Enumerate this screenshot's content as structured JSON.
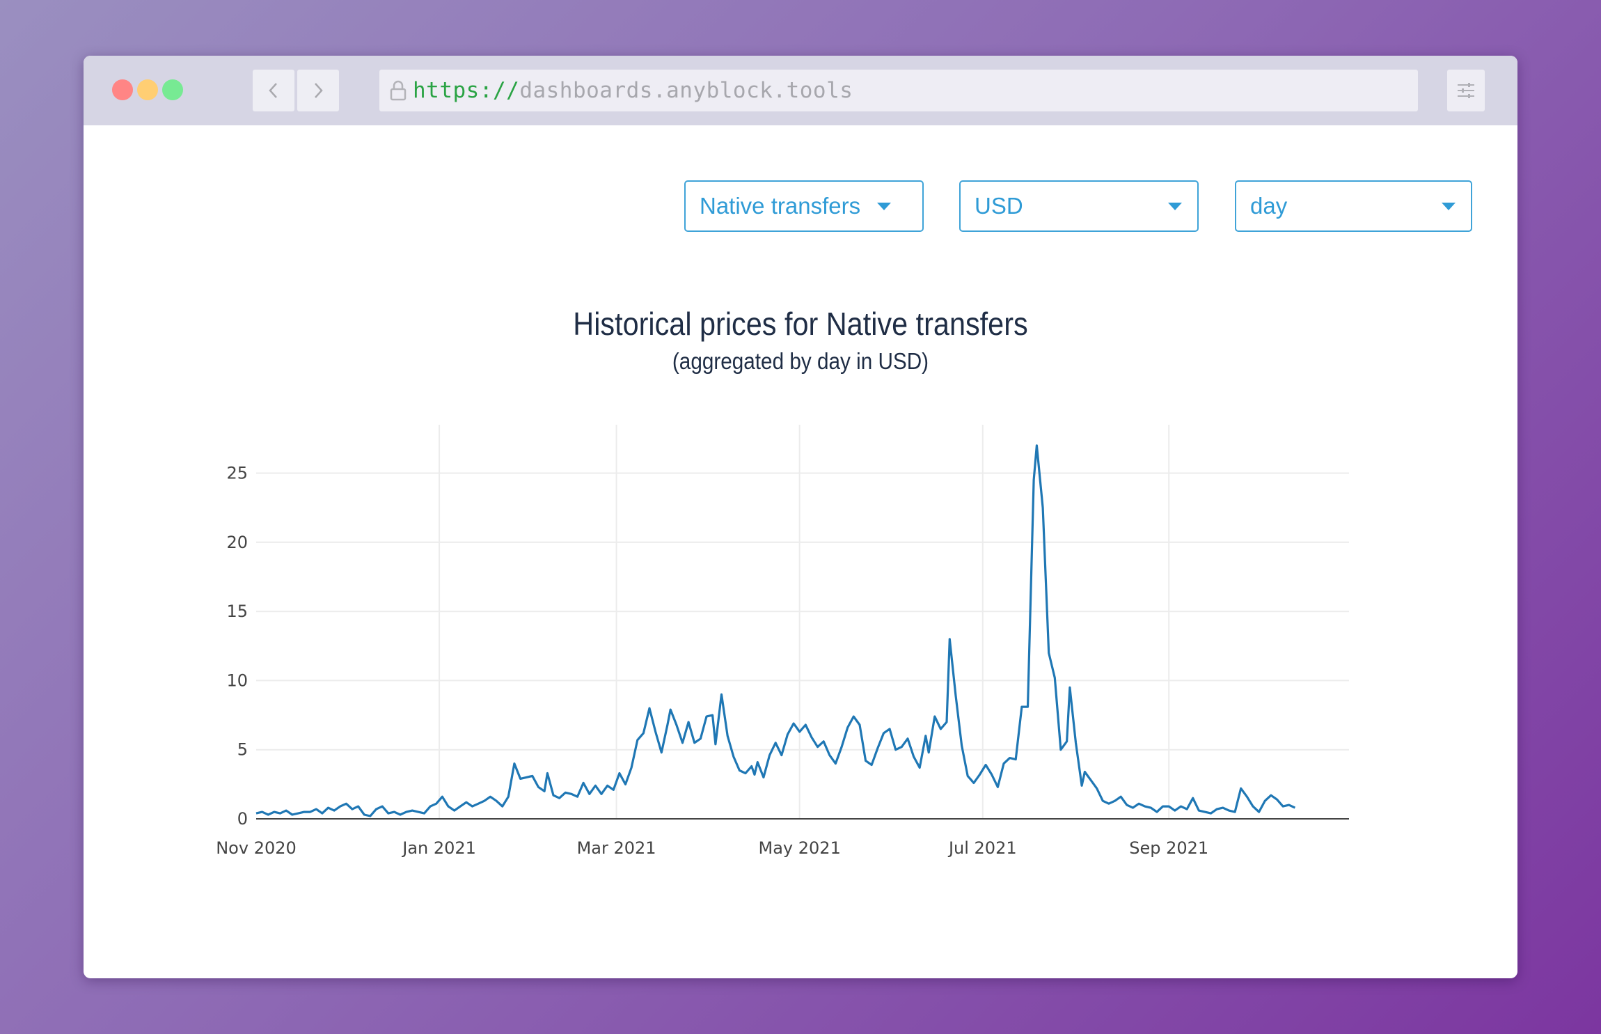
{
  "browser": {
    "url_scheme": "https://",
    "url_host": "dashboards.anyblock.tools",
    "icons": {
      "back": "chevron-left-icon",
      "forward": "chevron-right-icon",
      "lock": "lock-icon",
      "settings": "sliders-icon"
    },
    "traffic_lights": [
      "#ff8585",
      "#ffce73",
      "#77ea93"
    ]
  },
  "controls": {
    "metric_select": {
      "value": "Native transfers"
    },
    "currency_select": {
      "value": "USD"
    },
    "interval_select": {
      "value": "day"
    },
    "accent_color": "#2f9bd6"
  },
  "chart_data": {
    "type": "line",
    "title": "Historical prices for Native transfers",
    "subtitle": "(aggregated by day in USD)",
    "xlabel": "",
    "ylabel": "",
    "x_tick_labels": [
      "Nov 2020",
      "Jan 2021",
      "Mar 2021",
      "May 2021",
      "Jul 2021",
      "Sep 2021"
    ],
    "x_ticks": [
      "2020-11-01",
      "2021-01-01",
      "2021-03-01",
      "2021-05-01",
      "2021-07-01",
      "2021-09-01"
    ],
    "y_ticks": [
      0,
      5,
      10,
      15,
      20,
      25
    ],
    "ylim": [
      0,
      28.5
    ],
    "xlim": [
      "2020-11-01",
      "2021-10-31"
    ],
    "grid": true,
    "legend": "none",
    "line_color": "#1f77b4",
    "series": [
      {
        "name": "Native transfers",
        "points": [
          [
            "2020-11-01",
            0.4
          ],
          [
            "2020-11-03",
            0.5
          ],
          [
            "2020-11-05",
            0.3
          ],
          [
            "2020-11-07",
            0.5
          ],
          [
            "2020-11-09",
            0.4
          ],
          [
            "2020-11-11",
            0.6
          ],
          [
            "2020-11-13",
            0.3
          ],
          [
            "2020-11-15",
            0.4
          ],
          [
            "2020-11-17",
            0.5
          ],
          [
            "2020-11-19",
            0.5
          ],
          [
            "2020-11-21",
            0.7
          ],
          [
            "2020-11-23",
            0.4
          ],
          [
            "2020-11-25",
            0.8
          ],
          [
            "2020-11-27",
            0.6
          ],
          [
            "2020-11-29",
            0.9
          ],
          [
            "2020-12-01",
            1.1
          ],
          [
            "2020-12-03",
            0.7
          ],
          [
            "2020-12-05",
            0.9
          ],
          [
            "2020-12-07",
            0.3
          ],
          [
            "2020-12-09",
            0.2
          ],
          [
            "2020-12-11",
            0.7
          ],
          [
            "2020-12-13",
            0.9
          ],
          [
            "2020-12-15",
            0.4
          ],
          [
            "2020-12-17",
            0.5
          ],
          [
            "2020-12-19",
            0.3
          ],
          [
            "2020-12-21",
            0.5
          ],
          [
            "2020-12-23",
            0.6
          ],
          [
            "2020-12-25",
            0.5
          ],
          [
            "2020-12-27",
            0.4
          ],
          [
            "2020-12-29",
            0.9
          ],
          [
            "2020-12-31",
            1.1
          ],
          [
            "2021-01-02",
            1.6
          ],
          [
            "2021-01-04",
            0.9
          ],
          [
            "2021-01-06",
            0.6
          ],
          [
            "2021-01-08",
            0.9
          ],
          [
            "2021-01-10",
            1.2
          ],
          [
            "2021-01-12",
            0.9
          ],
          [
            "2021-01-14",
            1.1
          ],
          [
            "2021-01-16",
            1.3
          ],
          [
            "2021-01-18",
            1.6
          ],
          [
            "2021-01-20",
            1.3
          ],
          [
            "2021-01-22",
            0.9
          ],
          [
            "2021-01-24",
            1.6
          ],
          [
            "2021-01-26",
            4.0
          ],
          [
            "2021-01-28",
            2.9
          ],
          [
            "2021-01-30",
            3.0
          ],
          [
            "2021-02-01",
            3.1
          ],
          [
            "2021-02-03",
            2.3
          ],
          [
            "2021-02-05",
            2.0
          ],
          [
            "2021-02-06",
            3.3
          ],
          [
            "2021-02-08",
            1.7
          ],
          [
            "2021-02-10",
            1.5
          ],
          [
            "2021-02-12",
            1.9
          ],
          [
            "2021-02-14",
            1.8
          ],
          [
            "2021-02-16",
            1.6
          ],
          [
            "2021-02-18",
            2.6
          ],
          [
            "2021-02-20",
            1.8
          ],
          [
            "2021-02-22",
            2.4
          ],
          [
            "2021-02-24",
            1.8
          ],
          [
            "2021-02-26",
            2.4
          ],
          [
            "2021-02-28",
            2.1
          ],
          [
            "2021-03-02",
            3.3
          ],
          [
            "2021-03-04",
            2.5
          ],
          [
            "2021-03-06",
            3.7
          ],
          [
            "2021-03-08",
            5.7
          ],
          [
            "2021-03-10",
            6.2
          ],
          [
            "2021-03-12",
            8.0
          ],
          [
            "2021-03-14",
            6.3
          ],
          [
            "2021-03-16",
            4.8
          ],
          [
            "2021-03-18",
            6.8
          ],
          [
            "2021-03-19",
            7.9
          ],
          [
            "2021-03-21",
            6.8
          ],
          [
            "2021-03-23",
            5.5
          ],
          [
            "2021-03-25",
            7.0
          ],
          [
            "2021-03-27",
            5.5
          ],
          [
            "2021-03-29",
            5.8
          ],
          [
            "2021-03-31",
            7.4
          ],
          [
            "2021-04-02",
            7.5
          ],
          [
            "2021-04-03",
            5.4
          ],
          [
            "2021-04-05",
            9.0
          ],
          [
            "2021-04-07",
            6.0
          ],
          [
            "2021-04-09",
            4.5
          ],
          [
            "2021-04-11",
            3.5
          ],
          [
            "2021-04-13",
            3.3
          ],
          [
            "2021-04-15",
            3.8
          ],
          [
            "2021-04-16",
            3.2
          ],
          [
            "2021-04-17",
            4.1
          ],
          [
            "2021-04-19",
            3.0
          ],
          [
            "2021-04-21",
            4.6
          ],
          [
            "2021-04-23",
            5.5
          ],
          [
            "2021-04-25",
            4.6
          ],
          [
            "2021-04-27",
            6.1
          ],
          [
            "2021-04-29",
            6.9
          ],
          [
            "2021-05-01",
            6.3
          ],
          [
            "2021-05-03",
            6.8
          ],
          [
            "2021-05-05",
            5.9
          ],
          [
            "2021-05-07",
            5.2
          ],
          [
            "2021-05-09",
            5.6
          ],
          [
            "2021-05-11",
            4.6
          ],
          [
            "2021-05-13",
            4.0
          ],
          [
            "2021-05-15",
            5.2
          ],
          [
            "2021-05-17",
            6.6
          ],
          [
            "2021-05-19",
            7.4
          ],
          [
            "2021-05-21",
            6.8
          ],
          [
            "2021-05-23",
            4.2
          ],
          [
            "2021-05-25",
            3.9
          ],
          [
            "2021-05-27",
            5.1
          ],
          [
            "2021-05-29",
            6.2
          ],
          [
            "2021-05-31",
            6.5
          ],
          [
            "2021-06-02",
            5.0
          ],
          [
            "2021-06-04",
            5.2
          ],
          [
            "2021-06-06",
            5.8
          ],
          [
            "2021-06-08",
            4.5
          ],
          [
            "2021-06-10",
            3.7
          ],
          [
            "2021-06-12",
            6.0
          ],
          [
            "2021-06-13",
            4.8
          ],
          [
            "2021-06-15",
            7.4
          ],
          [
            "2021-06-17",
            6.5
          ],
          [
            "2021-06-19",
            7.0
          ],
          [
            "2021-06-20",
            13.0
          ],
          [
            "2021-06-22",
            8.9
          ],
          [
            "2021-06-24",
            5.3
          ],
          [
            "2021-06-26",
            3.1
          ],
          [
            "2021-06-28",
            2.6
          ],
          [
            "2021-06-30",
            3.2
          ],
          [
            "2021-07-02",
            3.9
          ],
          [
            "2021-07-04",
            3.2
          ],
          [
            "2021-07-06",
            2.3
          ],
          [
            "2021-07-08",
            4.0
          ],
          [
            "2021-07-10",
            4.4
          ],
          [
            "2021-07-12",
            4.3
          ],
          [
            "2021-07-14",
            8.1
          ],
          [
            "2021-07-16",
            8.1
          ],
          [
            "2021-07-18",
            24.5
          ],
          [
            "2021-07-19",
            27.0
          ],
          [
            "2021-07-21",
            22.5
          ],
          [
            "2021-07-23",
            12.0
          ],
          [
            "2021-07-25",
            10.2
          ],
          [
            "2021-07-27",
            5.0
          ],
          [
            "2021-07-29",
            5.6
          ],
          [
            "2021-07-30",
            9.5
          ],
          [
            "2021-08-01",
            5.5
          ],
          [
            "2021-08-03",
            2.4
          ],
          [
            "2021-08-04",
            3.4
          ],
          [
            "2021-08-06",
            2.8
          ],
          [
            "2021-08-08",
            2.2
          ],
          [
            "2021-08-10",
            1.3
          ],
          [
            "2021-08-12",
            1.1
          ],
          [
            "2021-08-14",
            1.3
          ],
          [
            "2021-08-16",
            1.6
          ],
          [
            "2021-08-18",
            1.0
          ],
          [
            "2021-08-20",
            0.8
          ],
          [
            "2021-08-22",
            1.1
          ],
          [
            "2021-08-24",
            0.9
          ],
          [
            "2021-08-26",
            0.8
          ],
          [
            "2021-08-28",
            0.5
          ],
          [
            "2021-08-30",
            0.9
          ],
          [
            "2021-09-01",
            0.9
          ],
          [
            "2021-09-03",
            0.6
          ],
          [
            "2021-09-05",
            0.9
          ],
          [
            "2021-09-07",
            0.7
          ],
          [
            "2021-09-09",
            1.5
          ],
          [
            "2021-09-11",
            0.6
          ],
          [
            "2021-09-13",
            0.5
          ],
          [
            "2021-09-15",
            0.4
          ],
          [
            "2021-09-17",
            0.7
          ],
          [
            "2021-09-19",
            0.8
          ],
          [
            "2021-09-21",
            0.6
          ],
          [
            "2021-09-23",
            0.5
          ],
          [
            "2021-09-25",
            2.2
          ],
          [
            "2021-09-27",
            1.6
          ],
          [
            "2021-09-29",
            0.9
          ],
          [
            "2021-10-01",
            0.5
          ],
          [
            "2021-10-03",
            1.3
          ],
          [
            "2021-10-05",
            1.7
          ],
          [
            "2021-10-07",
            1.4
          ],
          [
            "2021-10-09",
            0.9
          ],
          [
            "2021-10-11",
            1.0
          ],
          [
            "2021-10-13",
            0.8
          ]
        ]
      }
    ]
  }
}
